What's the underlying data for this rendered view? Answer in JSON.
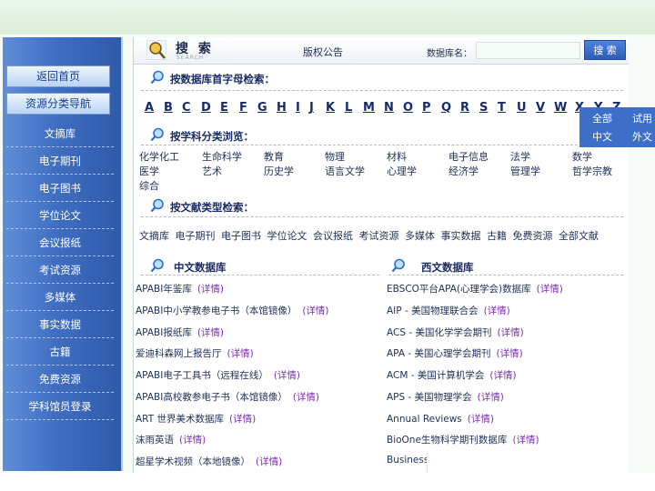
{
  "search_bar": {
    "title": "搜 索",
    "subtitle": "SEARCH",
    "tab_board": "版权公告",
    "db_name_label": "数据库名：",
    "db_name_value": "",
    "search_button": "搜 索"
  },
  "sidebar": {
    "home_button": "返回首页",
    "nav_button": "资源分类导航",
    "items": [
      "文摘库",
      "电子期刊",
      "电子图书",
      "学位论文",
      "会议报纸",
      "考试资源",
      "多媒体",
      "事实数据",
      "古籍",
      "免费资源",
      "学科馆员登录"
    ]
  },
  "sections": {
    "letter_search": "按数据库首字母检索：",
    "subject_browse": "按学科分类浏览：",
    "type_search": "按文献类型检索：",
    "chinese_db": "中文数据库",
    "western_db": "西文数据库"
  },
  "letters": [
    "A",
    "B",
    "C",
    "D",
    "E",
    "F",
    "G",
    "H",
    "I",
    "J",
    "K",
    "L",
    "M",
    "N",
    "O",
    "P",
    "Q",
    "R",
    "S",
    "T",
    "U",
    "V",
    "W",
    "X",
    "Y",
    "Z"
  ],
  "subjects": {
    "row1": [
      "化学化工",
      "生命科学",
      "教育",
      "物理",
      "材料",
      "电子信息",
      "法学",
      "数学"
    ],
    "row2": [
      "医学",
      "艺术",
      "历史学",
      "语言文学",
      "心理学",
      "经济学",
      "管理学",
      "哲学宗教"
    ],
    "row3": [
      "综合"
    ]
  },
  "doc_types": [
    "文摘库",
    "电子期刊",
    "电子图书",
    "学位论文",
    "会议报纸",
    "考试资源",
    "多媒体",
    "事实数据",
    "古籍",
    "免费资源",
    "全部文献"
  ],
  "chinese_dbs": [
    {
      "name": "APABI年鉴库",
      "detail": "(详情)"
    },
    {
      "name": "APABI中小学教参电子书（本馆镜像）",
      "detail": "(详情)"
    },
    {
      "name": "APABI报纸库",
      "detail": "(详情)"
    },
    {
      "name": "爱迪科森网上报告厅",
      "detail": "(详情)"
    },
    {
      "name": "APABI电子工具书（远程在线）",
      "detail": "(详情)"
    },
    {
      "name": "APABI高校教参电子书（本馆镜像）",
      "detail": "(详情)"
    },
    {
      "name": "ART 世界美术数据库",
      "detail": "(详情)"
    },
    {
      "name": "沫雨英语",
      "detail": "(详情)"
    },
    {
      "name": "超星学术视频（本地镜像）",
      "detail": "(详情)"
    }
  ],
  "western_dbs": [
    {
      "name": "EBSCO平台APA(心理学会)数据库",
      "detail": "(详情)"
    },
    {
      "name": "AIP - 美国物理联合会",
      "detail": "(详情)"
    },
    {
      "name": "ACS - 美国化学学会期刊",
      "detail": "(详情)"
    },
    {
      "name": "APA - 美国心理学会期刊",
      "detail": "(详情)"
    },
    {
      "name": "ACM - 美国计算机学会",
      "detail": "(详情)"
    },
    {
      "name": "APS - 美国物理学会",
      "detail": "(详情)"
    },
    {
      "name": "Annual Reviews",
      "detail": "(详情)"
    },
    {
      "name": "BioOne生物科学期刊数据库",
      "detail": "(详情)"
    },
    {
      "name": "Business",
      "detail": ""
    }
  ],
  "scope_tabs": {
    "all": "全部",
    "trial": "试用",
    "chinese": "中文",
    "foreign": "外文"
  },
  "colors": {
    "accent": "#3e6fc8",
    "detail": "#7b2fb0",
    "sidebar": "#3f6ec2"
  }
}
